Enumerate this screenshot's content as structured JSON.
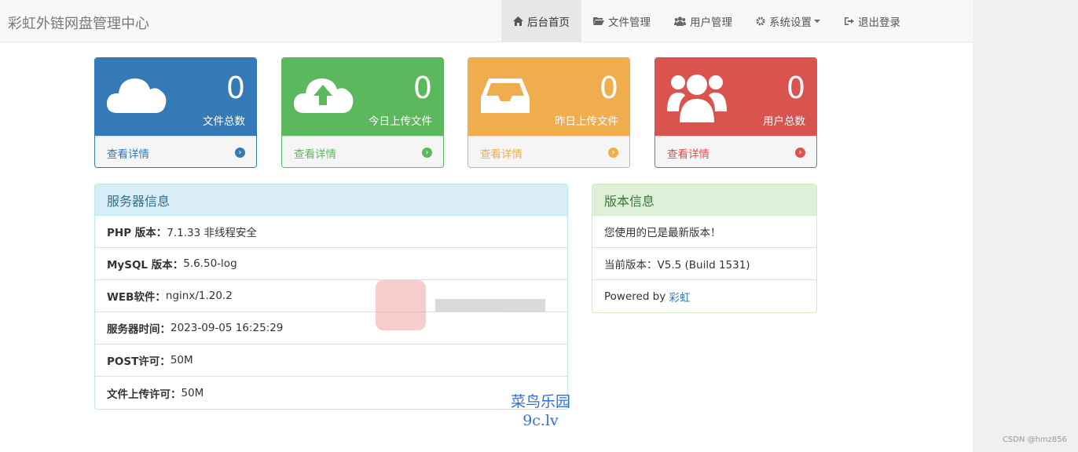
{
  "brand": "彩虹外链网盘管理中心",
  "nav": {
    "home": "后台首页",
    "files": "文件管理",
    "users": "用户管理",
    "settings": "系统设置",
    "logout": "退出登录"
  },
  "stats": [
    {
      "value": "0",
      "label": "文件总数",
      "link": "查看详情",
      "icon": "cloud-icon"
    },
    {
      "value": "0",
      "label": "今日上传文件",
      "link": "查看详情",
      "icon": "cloud-upload-icon"
    },
    {
      "value": "0",
      "label": "昨日上传文件",
      "link": "查看详情",
      "icon": "inbox-icon"
    },
    {
      "value": "0",
      "label": "用户总数",
      "link": "查看详情",
      "icon": "users-icon"
    }
  ],
  "server": {
    "title": "服务器信息",
    "rows": [
      {
        "label": "PHP 版本：",
        "value": "7.1.33 非线程安全"
      },
      {
        "label": "MySQL 版本：",
        "value": "5.6.50-log"
      },
      {
        "label": "WEB软件：",
        "value": "nginx/1.20.2"
      },
      {
        "label": "服务器时间：",
        "value": "2023-09-05 16:25:29"
      },
      {
        "label": "POST许可：",
        "value": "50M"
      },
      {
        "label": "文件上传许可：",
        "value": "50M"
      }
    ]
  },
  "version": {
    "title": "版本信息",
    "status": "您使用的已是最新版本！",
    "current": "当前版本：V5.5 (Build 1531)",
    "powered_prefix": "Powered by ",
    "powered_link": "彩虹"
  },
  "watermark": {
    "line1": "菜鸟乐园",
    "line2": "9c.lv"
  },
  "credit": "CSDN @hmz856",
  "colors": {
    "primary": "#337ab7",
    "success": "#5cb85c",
    "warning": "#f0ad4e",
    "danger": "#d9534f"
  }
}
